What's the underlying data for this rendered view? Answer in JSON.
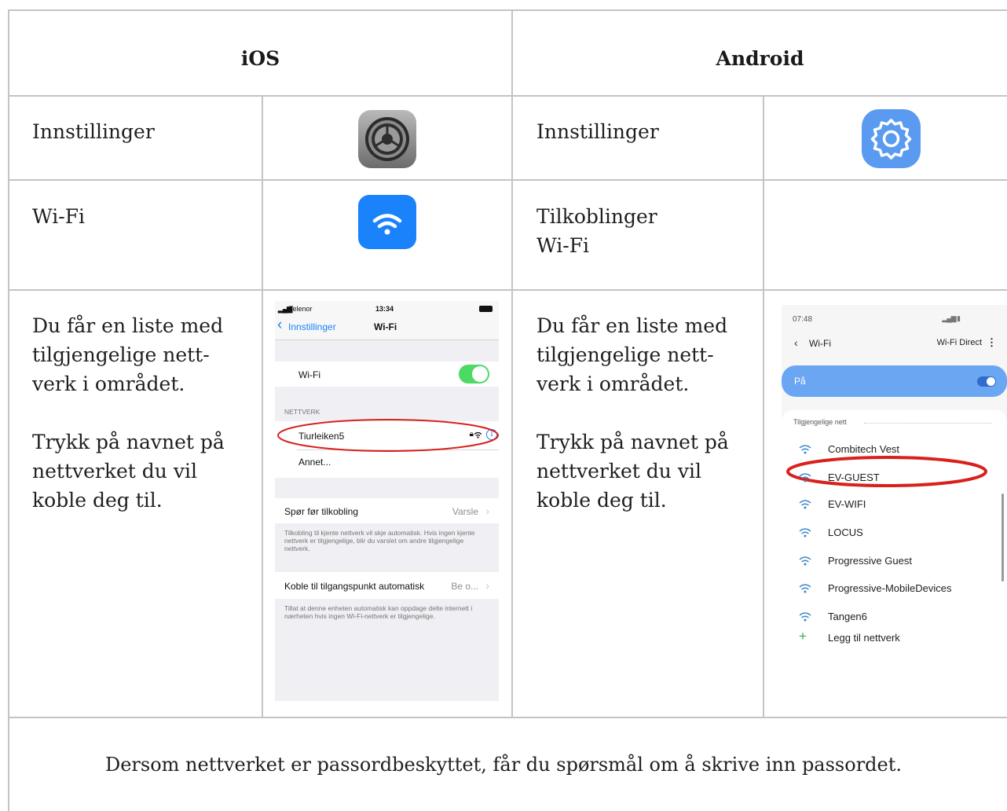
{
  "headers": {
    "ios": "iOS",
    "android": "Android"
  },
  "rows": {
    "settings": {
      "ios_label": "Innstillinger",
      "android_label": "Innstillinger"
    },
    "wifi": {
      "ios_label": "Wi-Fi",
      "android_line1": "Tilkoblinger",
      "android_line2": "Wi-Fi"
    },
    "list": {
      "ios_lines": [
        "Du får en liste med",
        "tilgjengelige nett-",
        "verk i området."
      ],
      "ios_lines2": [
        "Trykk på navnet på",
        "nettverket du vil",
        "koble deg til."
      ],
      "android_lines": [
        "Du får en liste med",
        "tilgjengelige nett-",
        "verk i området."
      ],
      "android_lines2": [
        "Trykk på navnet på",
        "nettverket du vil",
        "koble deg til."
      ]
    }
  },
  "ios_screen": {
    "carrier": "Telenor",
    "time": "13:34",
    "back_label": "Innstillinger",
    "title": "Wi-Fi",
    "wifi_row_label": "Wi-Fi",
    "section_label": "NETTVERK",
    "network_1": "Tiurleiken5",
    "network_other": "Annet...",
    "ask_label": "Spør før tilkobling",
    "ask_value": "Varsle",
    "ask_desc": "Tilkobling til kjente nettverk vil skje automatisk. Hvis ingen kjente nettverk er tilgjengelige, blir du varslet om andre tilgjengelige nettverk.",
    "hotspot_label": "Koble til tilgangspunkt automatisk",
    "hotspot_value": "Be o...",
    "hotspot_desc": "Tillat at denne enheten automatisk kan oppdage delte internett i nærheten hvis ingen Wi-Fi-nettverk er tilgjengelige."
  },
  "android_screen": {
    "time": "07:48",
    "title": "Wi-Fi",
    "direct": "Wi-Fi Direct",
    "toggle_label": "På",
    "section_label": "Tilgjengelige nett",
    "networks": [
      "Combitech Vest",
      "EV-GUEST",
      "EV-WIFI",
      "LOCUS",
      "Progressive Guest",
      "Progressive-MobileDevices",
      "Tangen6"
    ],
    "add_label": "Legg til nettverk"
  },
  "footer": "Dersom nettverket er passordbeskyttet, får du spørsmål om å skrive inn passordet.",
  "colors": {
    "ios_blue": "#1a82fb",
    "ios_green": "#4cd964",
    "android_blue": "#5a9af0",
    "highlight_red": "#d9201c"
  }
}
